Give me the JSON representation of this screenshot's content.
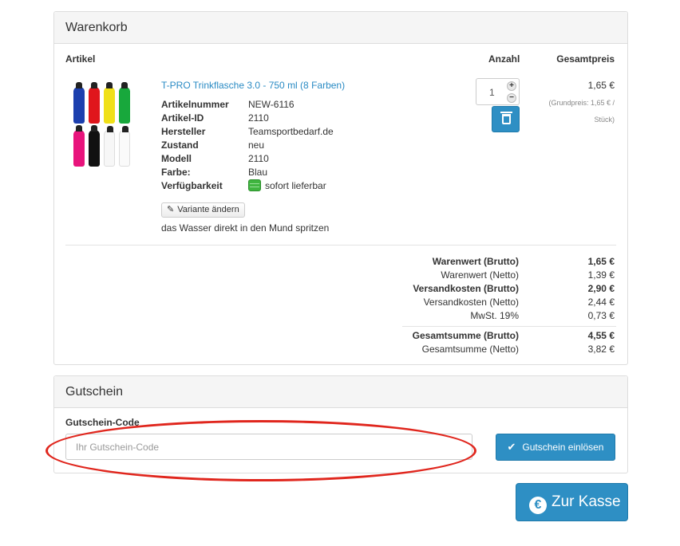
{
  "cart": {
    "heading": "Warenkorb",
    "col_article": "Artikel",
    "col_qty": "Anzahl",
    "col_total": "Gesamtpreis",
    "item": {
      "title": "T-PRO Trinkflasche 3.0 - 750 ml (8 Farben)",
      "specs": [
        {
          "key": "Artikelnummer",
          "value": "NEW-6116"
        },
        {
          "key": "Artikel-ID",
          "value": "2110"
        },
        {
          "key": "Hersteller",
          "value": "Teamsportbedarf.de"
        },
        {
          "key": "Zustand",
          "value": "neu"
        },
        {
          "key": "Modell",
          "value": "2110"
        },
        {
          "key": "Farbe:",
          "value": "Blau"
        },
        {
          "key": "Verfügbarkeit",
          "value": "sofort lieferbar"
        }
      ],
      "variant_button": "Variante ändern",
      "description": "das Wasser direkt in den Mund spritzen",
      "quantity": "1",
      "price": "1,65 €",
      "base_price": "(Grundpreis: 1,65 € / Stück)",
      "bottle_colors": [
        "#1c3fae",
        "#e0161c",
        "#f0e018",
        "#18a83c",
        "#e8147c",
        "#111111",
        "#f7f7f7",
        "#fafafa"
      ]
    },
    "summary": [
      {
        "label": "Warenwert (Brutto)",
        "value": "1,65 €",
        "bold": true
      },
      {
        "label": "Warenwert (Netto)",
        "value": "1,39 €",
        "bold": false
      },
      {
        "label": "Versandkosten (Brutto)",
        "value": "2,90 €",
        "bold": true
      },
      {
        "label": "Versandkosten (Netto)",
        "value": "2,44 €",
        "bold": false
      },
      {
        "label": "MwSt. 19%",
        "value": "0,73 €",
        "bold": false
      },
      {
        "label": "Gesamtsumme (Brutto)",
        "value": "4,55 €",
        "bold": true
      },
      {
        "label": "Gesamtsumme (Netto)",
        "value": "3,82 €",
        "bold": false
      }
    ]
  },
  "voucher": {
    "heading": "Gutschein",
    "label": "Gutschein-Code",
    "placeholder": "Ihr Gutschein-Code",
    "button": "Gutschein einlösen"
  },
  "checkout": {
    "button": "Zur Kasse"
  },
  "annotation_color": "#e0261d",
  "accent_color": "#2e8fc4"
}
